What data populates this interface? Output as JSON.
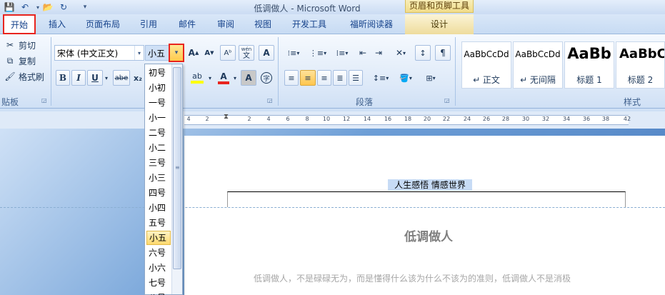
{
  "title_bar": {
    "title": "低调做人 - Microsoft Word",
    "context_group": "页眉和页脚工具",
    "quick_access": [
      {
        "icon": "save-icon",
        "glyph": "💾"
      },
      {
        "icon": "undo-icon",
        "glyph": "↶"
      },
      {
        "icon": "open-folder-icon",
        "glyph": "📂"
      },
      {
        "icon": "redo-icon",
        "glyph": "↻"
      },
      {
        "icon": "customize-quick-access-icon",
        "glyph": "▾"
      }
    ]
  },
  "tabs": [
    {
      "label": "开始",
      "active": true
    },
    {
      "label": "插入"
    },
    {
      "label": "页面布局"
    },
    {
      "label": "引用"
    },
    {
      "label": "邮件"
    },
    {
      "label": "审阅"
    },
    {
      "label": "视图"
    },
    {
      "label": "开发工具"
    },
    {
      "label": "福昕阅读器"
    },
    {
      "label": "设计",
      "context": true
    }
  ],
  "ribbon": {
    "clipboard": {
      "label": "贴板",
      "cut": "剪切",
      "copy": "复制",
      "format_painter": "格式刷"
    },
    "font": {
      "font_name": "宋体 (中文正文)",
      "font_size": "小五",
      "grow_glyph": "A",
      "shrink_glyph": "A",
      "clear_glyph": "Aᵇ",
      "wen_glyph": "wén",
      "bian_glyph": "变",
      "border_glyph": "A",
      "bold": "B",
      "italic": "I",
      "underline": "U",
      "strike": "abe",
      "subscript": "x₂",
      "highlight": "ab",
      "font_color": "A",
      "shading": "A",
      "enclose": "字"
    },
    "paragraph": {
      "label": "段落"
    },
    "styles": {
      "label": "样式",
      "items": [
        {
          "sample": "AaBbCcDd",
          "name": "↵ 正文"
        },
        {
          "sample": "AaBbCcDd",
          "name": "↵ 无间隔"
        },
        {
          "sample": "AaBb",
          "name": "标题 1"
        },
        {
          "sample": "AaBbC",
          "name": "标题 2"
        }
      ]
    }
  },
  "ruler": {
    "labels": [
      "4",
      "2",
      "2",
      "4",
      "6",
      "8",
      "10",
      "12",
      "14",
      "16",
      "18",
      "20",
      "22",
      "24",
      "26",
      "28",
      "30",
      "32",
      "34",
      "36",
      "38",
      "42"
    ]
  },
  "document": {
    "header_text": "人生感悟  情感世界",
    "title": "低调做人",
    "body_line": "低调做人，不是碌碌无为，而是懂得什么该为什么不该为的准则，低调做人不是消极"
  },
  "font_size_dropdown": {
    "options": [
      "初号",
      "小初",
      "一号",
      "小一",
      "二号",
      "小二",
      "三号",
      "小三",
      "四号",
      "小四",
      "五号",
      "小五",
      "六号",
      "小六",
      "七号",
      "八号"
    ],
    "selected": "小五"
  },
  "colors": {
    "highlight_bar": "#ffff00",
    "font_color_bar": "#e8251f",
    "annotation_box": "#e8251f"
  }
}
